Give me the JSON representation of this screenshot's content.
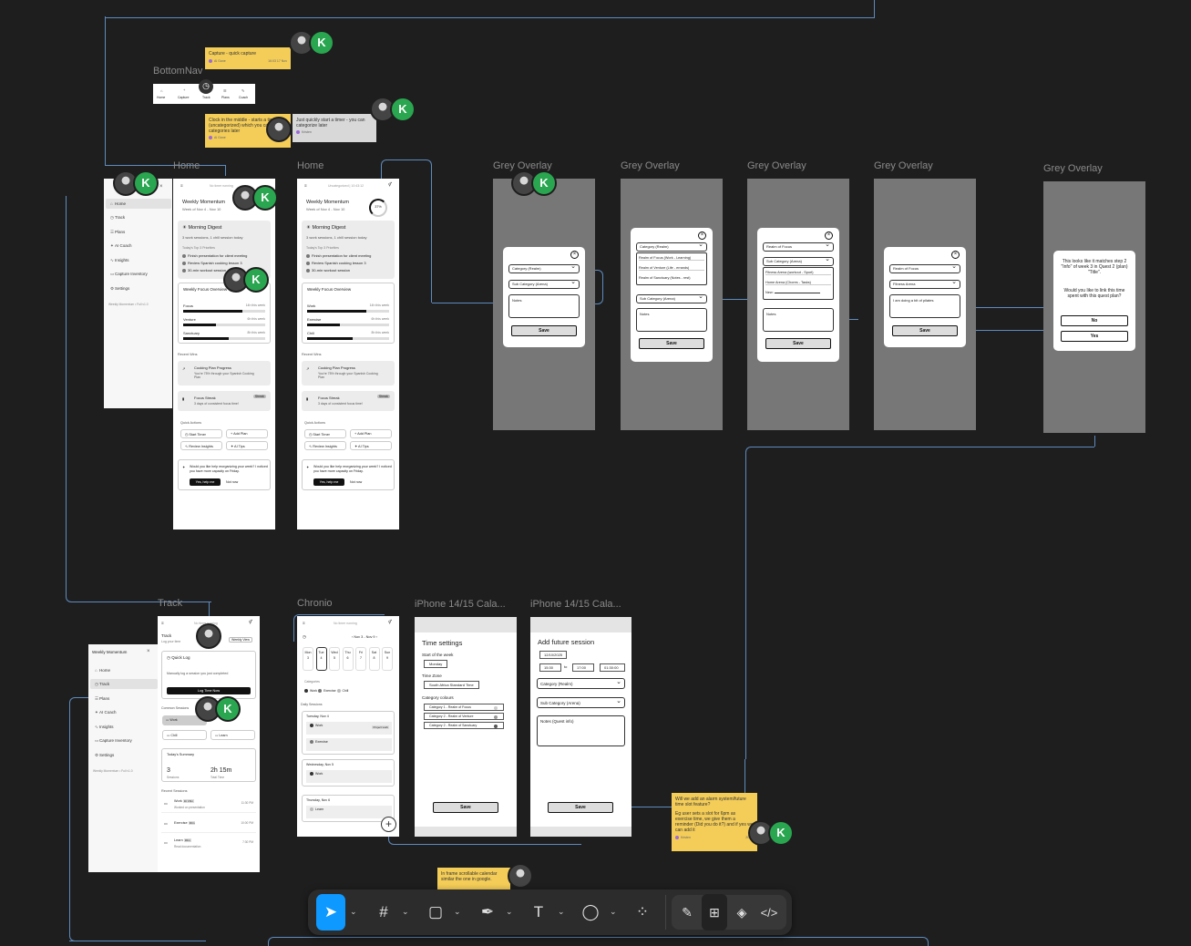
{
  "frames": {
    "bottom_nav": "BottomNav",
    "home1": "Home",
    "home2": "Home",
    "grey1": "Grey Overlay",
    "grey2": "Grey Overlay",
    "grey3": "Grey Overlay",
    "grey4": "Grey Overlay",
    "grey5": "Grey Overlay",
    "track": "Track",
    "chronio": "Chronio",
    "iphone1": "iPhone 14/15 Cala...",
    "iphone2": "iPhone 14/15 Cala..."
  },
  "bottom_nav": {
    "items": [
      "Home",
      "Capture",
      "Track",
      "Plans",
      "Coach"
    ]
  },
  "stickies": {
    "s1": {
      "text": "Capture - quick capture",
      "author": "Al Gane",
      "time": "16:03 17 Nov"
    },
    "s2": {
      "text": "Clock in the middle - starts a timer (uncategorized) which you can categories later",
      "author": "Al Gane"
    },
    "s3": {
      "text": "Just quickly start a timer - you can categorize later",
      "author": "Kristen"
    },
    "s4": {
      "text": "Will we add an alarm system/future time slot feature?",
      "text2": "Eg user sets a slot for 6pm as exercise time, we give them a reminder (Did you do it?) and if yes we can add it",
      "author": "Kristen",
      "time": "20:09"
    },
    "s5": {
      "text": "In frame scrollable calendar similar the one in google."
    }
  },
  "avatar_k": "K",
  "sidebar": {
    "items": [
      "Home",
      "Track",
      "Plans",
      "AI Coach",
      "Insights",
      "Capture Inventory",
      "Settings"
    ],
    "footer": "Weekly Momentum • Full v1.0"
  },
  "home": {
    "status": "No timer running",
    "status2": "Uncategorized | 10:43:12",
    "title": "Weekly Momentum",
    "week": "Week of Nov 4 - Nov 10",
    "ring": "37%",
    "digest_title": "Morning Digest",
    "digest_sub": "3 work sessions, 1 chill session today",
    "priorities_label": "Today's Top 3 Priorities",
    "priorities": [
      "Finish presentation for client meeting",
      "Review Spanish cooking lesson 3",
      "30-min workout session"
    ],
    "overview_title": "Weekly Focus Overview",
    "focus": [
      {
        "name": "Focus",
        "value": "14h this week",
        "pct": 0.72
      },
      {
        "name": "Venture",
        "value": "6h this week",
        "pct": 0.4
      },
      {
        "name": "Sanctuary",
        "value": "8h this week",
        "pct": 0.55
      }
    ],
    "focus2": [
      {
        "name": "Work",
        "value": "14h this week",
        "pct": 0.72
      },
      {
        "name": "Exercise",
        "value": "6h this week",
        "pct": 0.4
      },
      {
        "name": "Chill",
        "value": "8h this week",
        "pct": 0.55
      }
    ],
    "recent_wins": "Recent Wins",
    "win1_title": "Cooking Plan Progress",
    "win1_sub": "You're 75% through your Spanish Cooking Plan",
    "win2_title": "Focus Streak",
    "win2_badge": "Streak",
    "win2_sub": "3 days of consistent focus time!",
    "quick_actions": "Quick Actions",
    "qa": [
      "Start Timer",
      "Add Plan",
      "Review Insights",
      "AI Tips"
    ],
    "coach_text": "Would you like help reorganizing your week? I noticed you have more capacity on Friday.",
    "yes": "Yes, help me",
    "not_now": "Not now"
  },
  "modals": {
    "category": "Category (Realm)",
    "subcategory": "Sub Category (Arena)",
    "notes": "Notes",
    "save": "Save",
    "realms": [
      "Realm of Focus (Work - Learning)",
      "Realm of Venture (Life - errands)",
      "Realm of Sanctuary (Notes - rest)"
    ],
    "realm_focus": "Realm of Focus",
    "arenas": [
      "Fitness Arena (workout - Sport)",
      "Home Arena (Chores - Tasks)",
      "New:"
    ],
    "fitness": "Fitness Arena",
    "note_text": "I am doing a bit of pilates",
    "question": "This looks like it matches step 2 \"Info\" of week 3 in Quest 2 (plan) \"Title\".",
    "question2": "Would you like to link this time spent with this quest plan?",
    "no": "No",
    "yes": "Yes"
  },
  "track": {
    "title": "Track",
    "sub": "Log your time",
    "view": "Weekly View",
    "quick_log": "Quick Log",
    "quick_sub": "Manually log a session you just completed",
    "log_btn": "Log Time Now",
    "common": "Common Sessions",
    "sessions": [
      "Work",
      "Chill",
      "Learn"
    ],
    "summary": "Today's Summary",
    "sessions_n": "3",
    "sessions_l": "Sessions",
    "total": "2h 15m",
    "total_l": "Total Time",
    "recent": "Recent Sessions",
    "recent_items": [
      {
        "name": "Work",
        "badge": "1h 15m",
        "sub": "Worked on presentation",
        "time": "11:30 PM"
      },
      {
        "name": "Exercise",
        "badge": "30m",
        "sub": "",
        "time": "10:00 PM"
      },
      {
        "name": "Learn",
        "badge": "30m",
        "sub": "Read documentation",
        "time": "7:30 PM"
      }
    ]
  },
  "chronio": {
    "range": "Nov 3 - Nov 9",
    "days": [
      [
        "Mon",
        "3"
      ],
      [
        "Tue",
        "4"
      ],
      [
        "Wed",
        "5"
      ],
      [
        "Thu",
        "6"
      ],
      [
        "Fri",
        "7"
      ],
      [
        "Sat",
        "8"
      ],
      [
        "Sun",
        "9"
      ]
    ],
    "categories": "Categories",
    "cats": [
      "Work",
      "Exercise",
      "Chill"
    ],
    "daily": "Daily Sessions",
    "d1": "Tuesday, Nov 4",
    "d2": "Wednesday, Nov 5",
    "d3": "Thursday, Nov 6",
    "s_work": "Work",
    "s_ex": "Exercise",
    "s_learn": "Learn",
    "project": "Project work"
  },
  "time_settings": {
    "title": "Time settings",
    "start": "Start of the week",
    "start_val": "Monday",
    "tz": "Time Zone",
    "tz_val": "South Africa Standard Time",
    "colours": "Category colours",
    "cat_items": [
      "Category 1 - Realm of Focus",
      "Category 2 - Realm of Venture",
      "Category 2 - Realm of Sanctuary"
    ],
    "save": "Save"
  },
  "future": {
    "title": "Add future session",
    "date": "12/10/2025",
    "from": "15:30",
    "to_label": "to",
    "to": "17:00",
    "dur": "01:30:00",
    "category": "Category (Realm)",
    "sub": "Sub Category (Arena)",
    "notes": "Notes (Quest info)",
    "save": "Save"
  }
}
